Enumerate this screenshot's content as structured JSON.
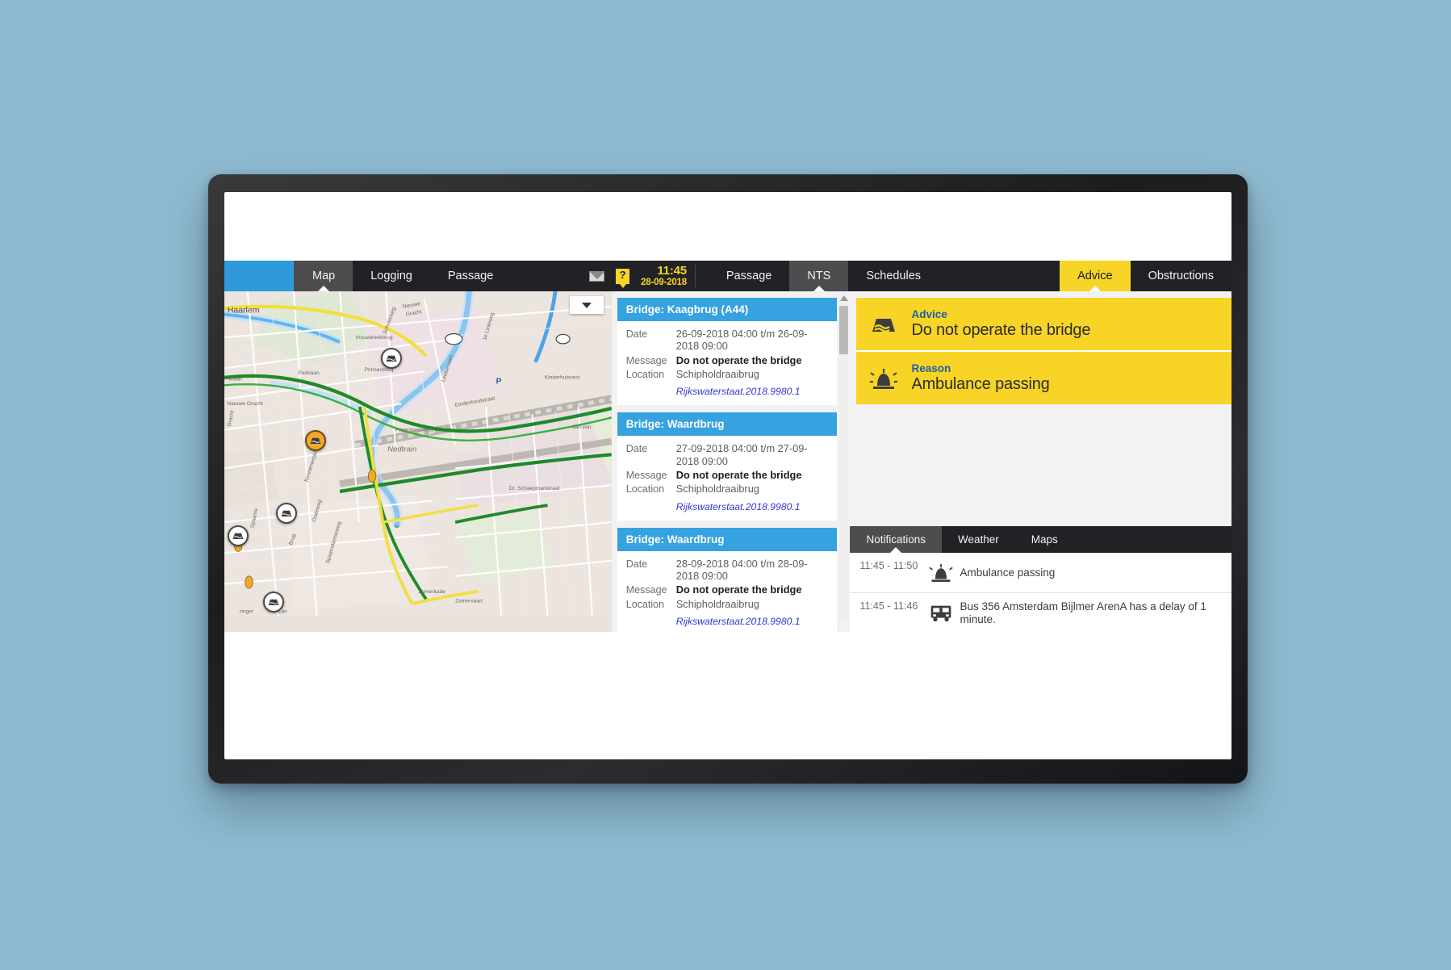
{
  "app": {
    "toolbar": {
      "logo": "",
      "tabs": [
        {
          "label": "Map",
          "active": true
        },
        {
          "label": "Logging",
          "active": false
        },
        {
          "label": "Passage",
          "active": false
        }
      ],
      "mail_icon": "mail-icon",
      "help_icon": "help-icon",
      "help_glyph": "?",
      "clock_time": "11:45",
      "clock_date": "28-09-2018",
      "center_tabs": [
        {
          "label": "Passage",
          "active": false
        },
        {
          "label": "NTS",
          "active": true
        },
        {
          "label": "Schedules",
          "active": false
        }
      ],
      "right_tabs": [
        {
          "label": "Advice",
          "active": true
        },
        {
          "label": "Obstructions",
          "active": false
        }
      ]
    },
    "map": {
      "dropdown_icon": "chevron-down-icon",
      "labels": [
        "Haarlem",
        "Nieuwe Gracht",
        "Vrouwehekbrug",
        "Prinsenbrug",
        "Papentorenvest",
        "Nedtrain",
        "Dr. Schaepmanstraat",
        "Spaarne",
        "Zomerkade",
        "Zomervaart",
        "Leidsevaart",
        "Gracht",
        "Parklaan",
        "Kinderhuisvest",
        "Jan van Galenstraat"
      ],
      "markers": [
        {
          "name": "bridge-marker-1",
          "type": "bridge",
          "highlight": false
        },
        {
          "name": "bridge-marker-2",
          "type": "bridge",
          "highlight": true
        },
        {
          "name": "bridge-marker-3",
          "type": "bridge",
          "highlight": false
        },
        {
          "name": "bridge-marker-4",
          "type": "bridge",
          "highlight": false
        },
        {
          "name": "bridge-marker-5",
          "type": "bridge",
          "highlight": false
        }
      ]
    },
    "nts": {
      "scrollbar": "vertical-scrollbar",
      "cards": [
        {
          "title": "Bridge: Kaagbrug (A44)",
          "date_label": "Date",
          "date_value": "26-09-2018 04:00 t/m 26-09-2018 09:00",
          "message_label": "Message",
          "message_value": "Do not operate the bridge",
          "location_label": "Location",
          "location_value": "Schipholdraaibrug",
          "reference": "Rijkswaterstaat.2018.9980.1"
        },
        {
          "title": "Bridge: Waardbrug",
          "date_label": "Date",
          "date_value": "27-09-2018 04:00 t/m 27-09-2018 09:00",
          "message_label": "Message",
          "message_value": "Do not operate the bridge",
          "location_label": "Location",
          "location_value": "Schipholdraaibrug",
          "reference": "Rijkswaterstaat.2018.9980.1"
        },
        {
          "title": "Bridge: Waardbrug",
          "date_label": "Date",
          "date_value": "28-09-2018 04:00 t/m 28-09-2018 09:00",
          "message_label": "Message",
          "message_value": "Do not operate the bridge",
          "location_label": "Location",
          "location_value": "Schipholdraaibrug",
          "reference": "Rijkswaterstaat.2018.9980.1"
        }
      ]
    },
    "advice": {
      "accent_color": "#f8d426",
      "rows": [
        {
          "icon": "bridge-icon",
          "label": "Advice",
          "text": "Do not operate the bridge"
        },
        {
          "icon": "siren-icon",
          "label": "Reason",
          "text": "Ambulance passing"
        }
      ]
    },
    "notifications": {
      "tabs": [
        {
          "label": "Notifications",
          "active": true
        },
        {
          "label": "Weather",
          "active": false
        },
        {
          "label": "Maps",
          "active": false
        }
      ],
      "items": [
        {
          "time": "11:45 - 11:50",
          "icon": "siren-icon",
          "message": "Ambulance passing"
        },
        {
          "time": "11:45 - 11:46",
          "icon": "bus-icon",
          "message": "Bus 356 Amsterdam Bijlmer ArenA has a delay of 1 minute."
        }
      ]
    }
  },
  "colors": {
    "background": "#8fbbd0",
    "toolbar": "#222226",
    "accent_blue": "#36a2e0",
    "accent_yellow": "#f8d426",
    "logo_blue": "#2f9ada",
    "link": "#3535d0"
  }
}
